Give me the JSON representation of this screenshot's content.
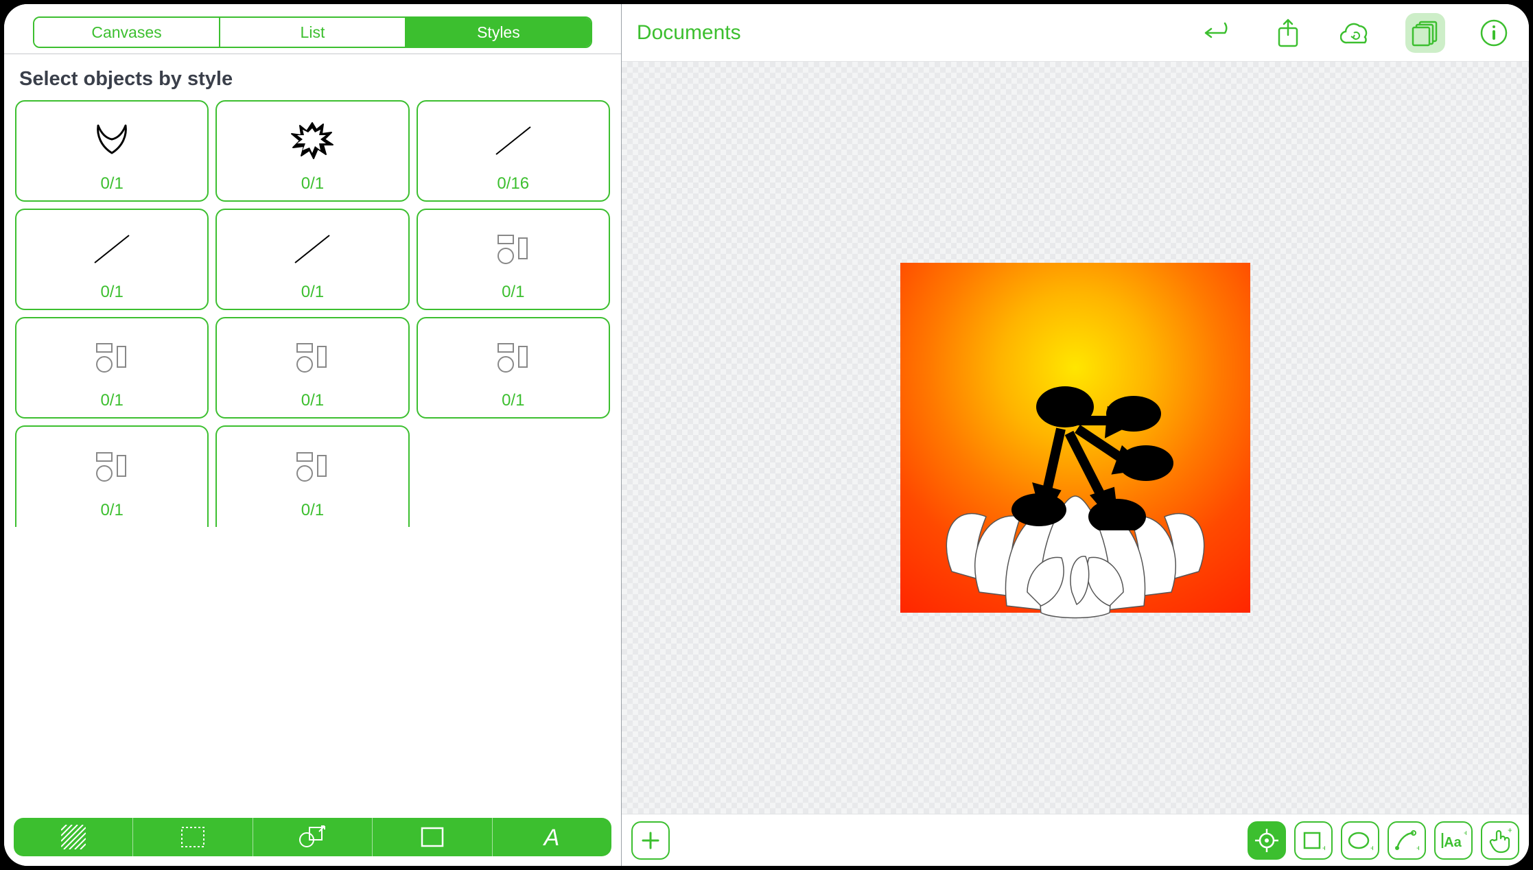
{
  "sidebar": {
    "tabs": [
      "Canvases",
      "List",
      "Styles"
    ],
    "active_tab_index": 2,
    "heading": "Select objects by style",
    "tiles": [
      {
        "icon": "horns",
        "count": "0/1"
      },
      {
        "icon": "spiky",
        "count": "0/1"
      },
      {
        "icon": "line",
        "count": "0/16"
      },
      {
        "icon": "line",
        "count": "0/1"
      },
      {
        "icon": "line",
        "count": "0/1"
      },
      {
        "icon": "shapes",
        "count": "0/1"
      },
      {
        "icon": "shapes",
        "count": "0/1"
      },
      {
        "icon": "shapes",
        "count": "0/1"
      },
      {
        "icon": "shapes",
        "count": "0/1"
      },
      {
        "icon": "shapes",
        "count": "0/1"
      },
      {
        "icon": "shapes",
        "count": "0/1"
      }
    ],
    "bottom_tools": [
      "fill-pattern",
      "selection-rect",
      "combine-shapes",
      "rect-stroke",
      "text-style"
    ]
  },
  "topbar": {
    "documents_label": "Documents",
    "icons": [
      "undo-icon",
      "share-icon",
      "cloud-sync-icon",
      "layers-icon",
      "info-icon"
    ],
    "selected_icon_index": 3
  },
  "bottombar": {
    "left": [
      "add-button"
    ],
    "right": [
      "target-tool",
      "rectangle-tool",
      "ellipse-tool",
      "pen-tool",
      "text-tool",
      "touch-tool"
    ],
    "active_right_index": 0
  },
  "colors": {
    "accent": "#3cbf2f"
  }
}
